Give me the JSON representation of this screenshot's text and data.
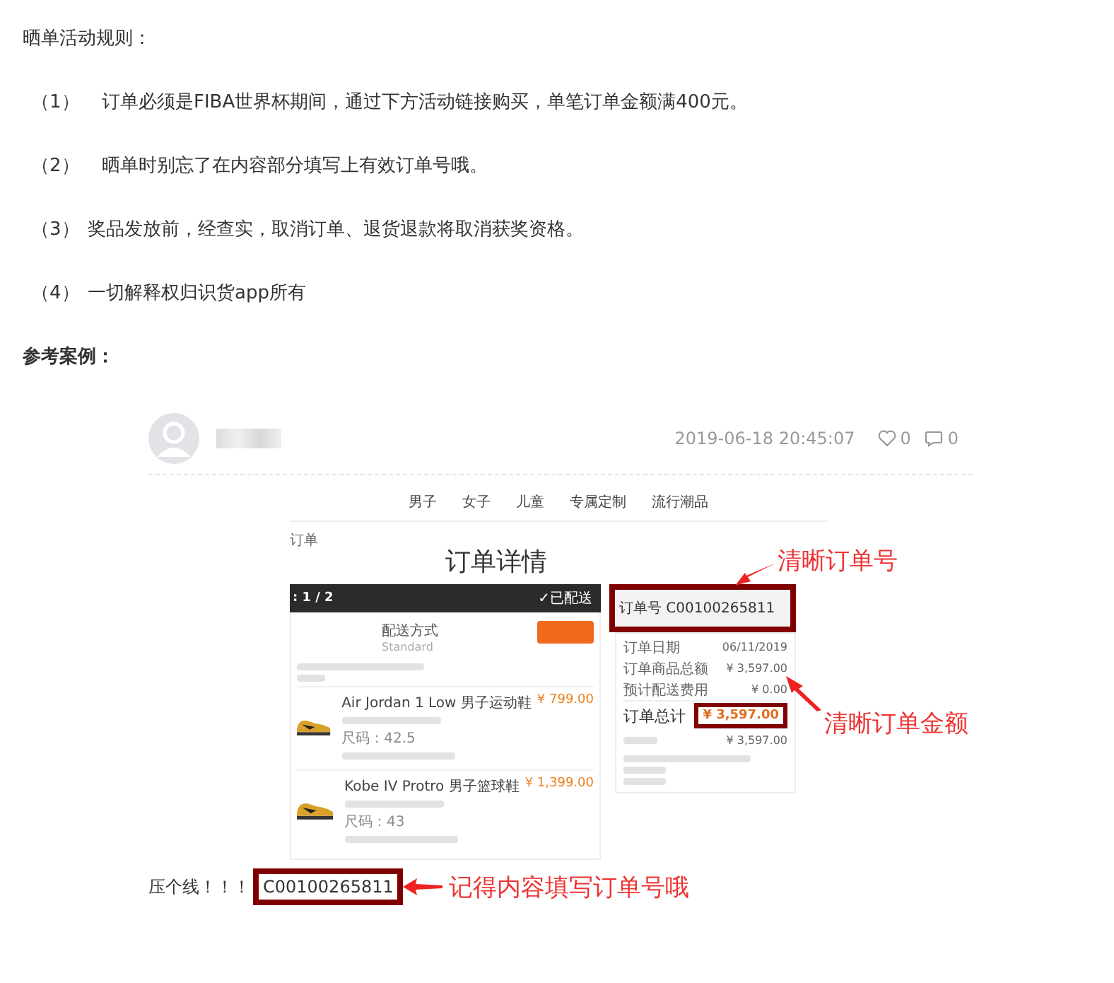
{
  "rules_title": "晒单活动规则：",
  "rules": [
    {
      "number": "（1）",
      "text": "订单必须是FIBA世界杯期间，通过下方活动链接购买，单笔订单金额满400元。",
      "wide": true
    },
    {
      "number": "（2）",
      "text": "晒单时别忘了在内容部分填写上有效订单号哦。",
      "wide": true
    },
    {
      "number": "（3）",
      "text": "奖品发放前，经查实，取消订单、退货退款将取消获奖资格。",
      "wide": false
    },
    {
      "number": "（4）",
      "text": "一切解释权归识货app所有",
      "wide": false
    }
  ],
  "example_title": "参考案例：",
  "post": {
    "timestamp": "2019-06-18 20:45:07",
    "likes": "0",
    "comments": "0",
    "nav": [
      "男子",
      "女子",
      "儿童",
      "专属定制",
      "流行潮品"
    ],
    "breadcrumb": "订单",
    "title": "订单详情",
    "shipment": ": 1 / 2",
    "status": "✓已配送",
    "delivery_label": "配送方式",
    "delivery_value": "Standard",
    "products": [
      {
        "name": "Air Jordan 1 Low 男子运动鞋",
        "size": "尺码：42.5",
        "price": "¥ 799.00"
      },
      {
        "name": "Kobe IV Protro 男子篮球鞋",
        "size": "尺码：43",
        "price": "¥ 1,399.00"
      }
    ],
    "order_number": "订单号 C00100265811",
    "summary": [
      {
        "label": "订单日期",
        "value": "06/11/2019"
      },
      {
        "label": "订单商品总额",
        "value": "¥ 3,597.00"
      },
      {
        "label": "预计配送费用",
        "value": "¥ 0.00"
      }
    ],
    "total_label": "订单总计",
    "total_value": "¥ 3,597.00",
    "paid_value": "¥ 3,597.00",
    "note_order": "清晰订单号",
    "note_total": "清晰订单金额",
    "footer_label": "压个线！！！",
    "footer_order": "C00100265811",
    "footer_note": "记得内容填写订单号哦"
  }
}
